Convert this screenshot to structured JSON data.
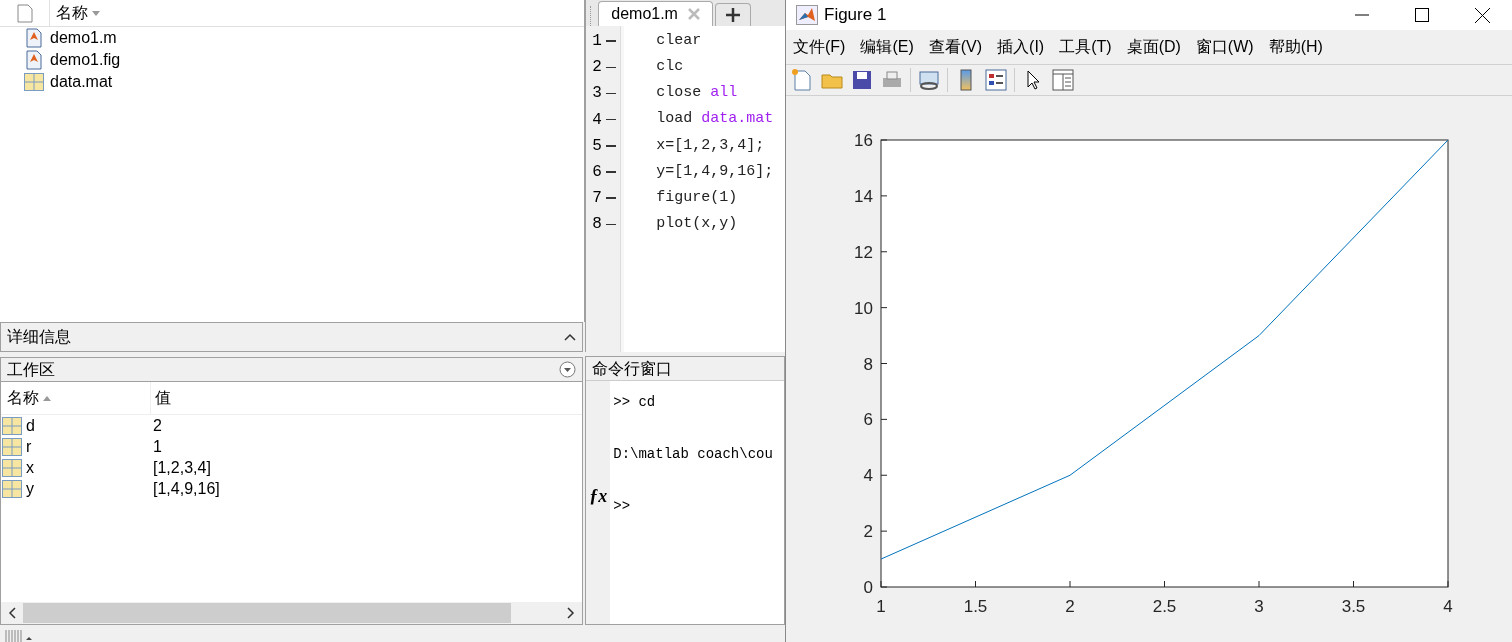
{
  "file_browser": {
    "column": "名称",
    "files": [
      {
        "name": "demo1.m",
        "kind": "m"
      },
      {
        "name": "demo1.fig",
        "kind": "fig"
      },
      {
        "name": "data.mat",
        "kind": "mat"
      }
    ]
  },
  "details": {
    "title": "详细信息"
  },
  "workspace": {
    "title": "工作区",
    "columns": [
      "名称",
      "值"
    ],
    "rows": [
      {
        "name": "d",
        "value": "2"
      },
      {
        "name": "r",
        "value": "1"
      },
      {
        "name": "x",
        "value": "[1,2,3,4]"
      },
      {
        "name": "y",
        "value": "[1,4,9,16]"
      }
    ]
  },
  "editor": {
    "tabs": [
      {
        "label": "demo1.m",
        "selected": true
      }
    ],
    "lines": [
      {
        "number": "1",
        "segments": [
          {
            "kind": "code",
            "text": "clear"
          }
        ]
      },
      {
        "number": "2",
        "segments": [
          {
            "kind": "code",
            "text": "clc"
          }
        ]
      },
      {
        "number": "3",
        "segments": [
          {
            "kind": "code",
            "text": "close "
          },
          {
            "kind": "string",
            "text": "all"
          }
        ]
      },
      {
        "number": "4",
        "segments": [
          {
            "kind": "code",
            "text": "load "
          },
          {
            "kind": "string",
            "text": "data.mat"
          }
        ]
      },
      {
        "number": "5",
        "segments": [
          {
            "kind": "code",
            "text": "x=[1,2,3,4];"
          }
        ]
      },
      {
        "number": "6",
        "segments": [
          {
            "kind": "code",
            "text": "y=[1,4,9,16];"
          }
        ]
      },
      {
        "number": "7",
        "segments": [
          {
            "kind": "code",
            "text": "figure(1)"
          }
        ]
      },
      {
        "number": "8",
        "segments": [
          {
            "kind": "code",
            "text": "plot(x,y)"
          }
        ]
      }
    ]
  },
  "command_window": {
    "title": "命令行窗口",
    "lines": [
      ">> cd",
      "D:\\matlab coach\\cou"
    ],
    "prompt": ">>",
    "function_icon": "ƒx"
  },
  "figure": {
    "title": "Figure 1",
    "menu": [
      "文件(F)",
      "编辑(E)",
      "查看(V)",
      "插入(I)",
      "工具(T)",
      "桌面(D)",
      "窗口(W)",
      "帮助(H)"
    ],
    "chart_data": {
      "type": "line",
      "x": [
        1,
        2,
        3,
        4
      ],
      "series": [
        {
          "color": "#0072bd",
          "values": [
            1,
            4,
            9,
            16
          ]
        }
      ],
      "xlim": [
        1,
        4
      ],
      "ylim": [
        0,
        16
      ],
      "xticks": [
        1,
        1.5,
        2,
        2.5,
        3,
        3.5,
        4
      ],
      "yticks": [
        0,
        2,
        4,
        6,
        8,
        10,
        12,
        14,
        16
      ]
    }
  }
}
